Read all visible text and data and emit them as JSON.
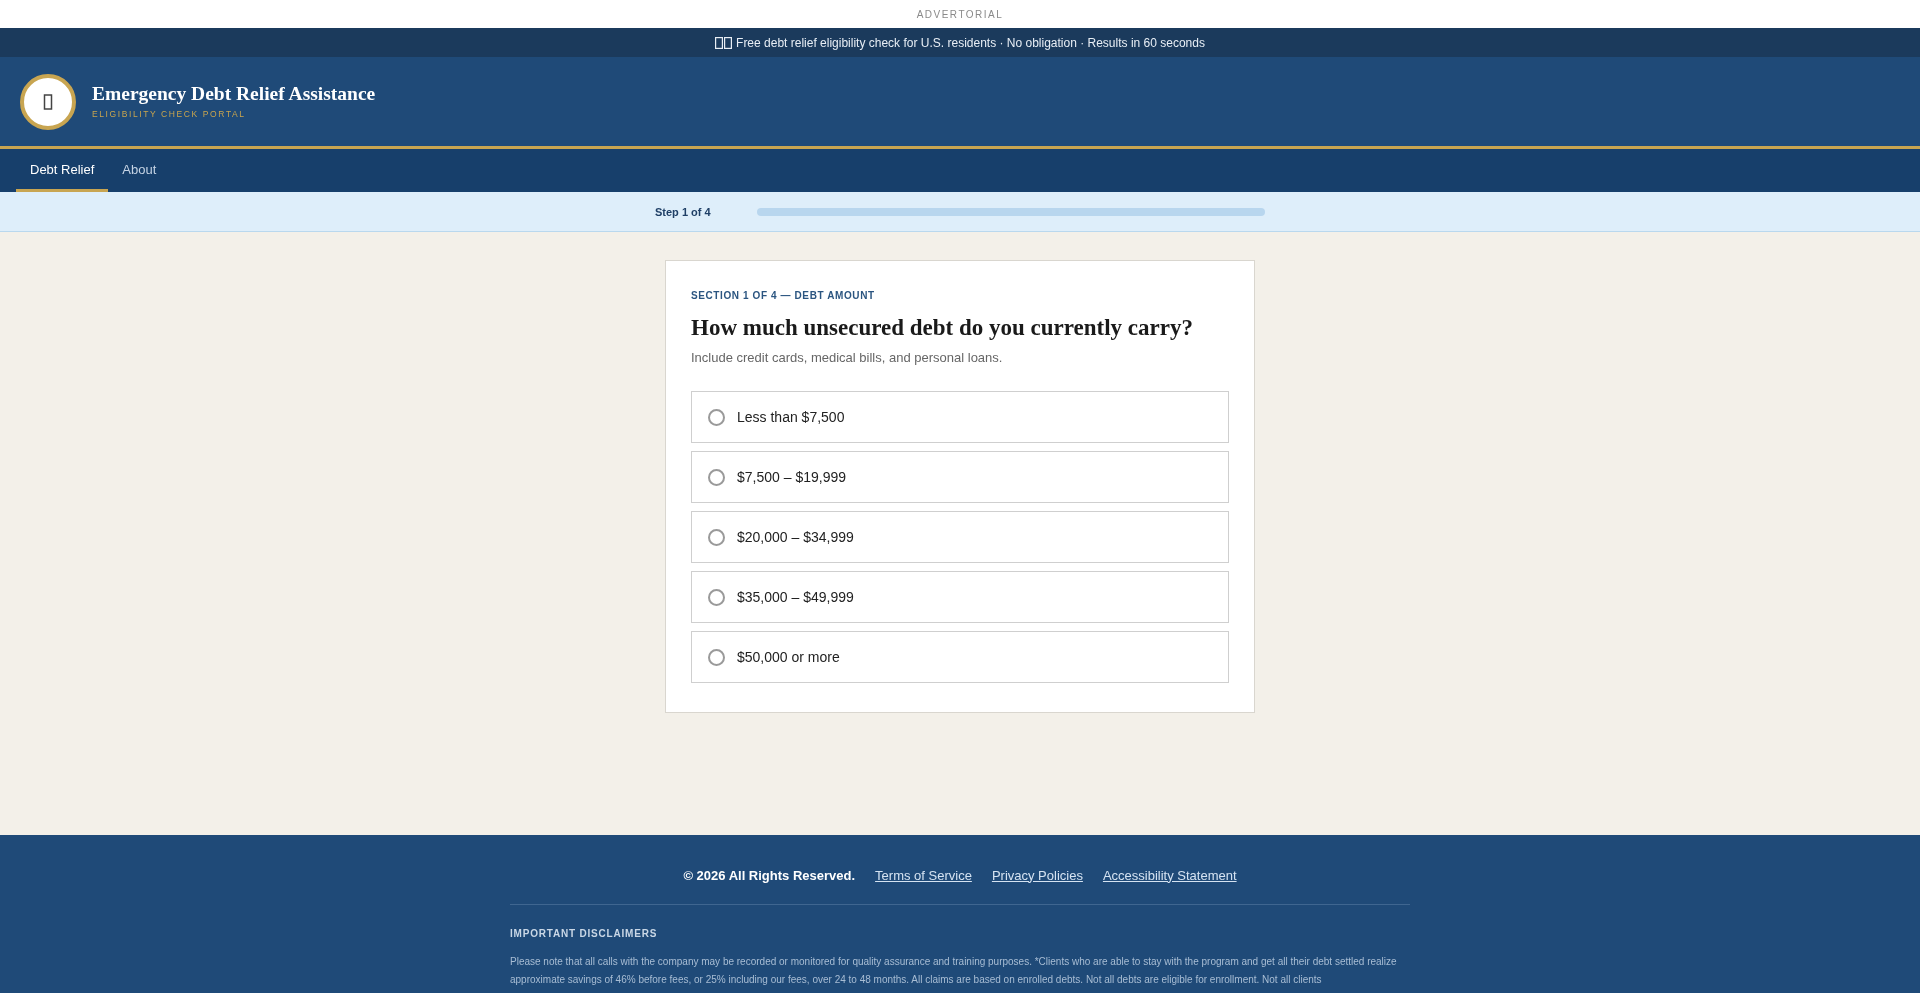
{
  "ad_label": "ADVERTORIAL",
  "banner": {
    "text": "Free debt relief eligibility check for U.S. residents · No obligation · Results in 60 seconds"
  },
  "header": {
    "title": "Emergency Debt Relief Assistance",
    "subtitle": "ELIGIBILITY CHECK PORTAL"
  },
  "nav": {
    "tabs": [
      {
        "label": "Debt Relief",
        "selected": true
      },
      {
        "label": "About",
        "selected": false
      }
    ]
  },
  "progress": {
    "label": "Step 1 of 4"
  },
  "question": {
    "eyebrow": "SECTION 1 OF 4 — DEBT AMOUNT",
    "title": "How much unsecured debt do you currently carry?",
    "hint": "Include credit cards, medical bills, and personal loans.",
    "options": [
      {
        "label": "Less than $7,500",
        "selected": false
      },
      {
        "label": "$7,500 – $19,999",
        "selected": false
      },
      {
        "label": "$20,000 – $34,999",
        "selected": false
      },
      {
        "label": "$35,000 – $49,999",
        "selected": false
      },
      {
        "label": "$50,000 or more",
        "selected": false
      }
    ]
  },
  "footer": {
    "copyright": "© 2026 All Rights Reserved.",
    "links": [
      "Terms of Service",
      "Privacy Policies",
      "Accessibility Statement"
    ],
    "disclaimer_title": "IMPORTANT DISCLAIMERS",
    "disclaimer": "Please note that all calls with the company may be recorded or monitored for quality assurance and training purposes. *Clients who are able to stay with the program and get all their debt settled realize approximate savings of 46% before fees, or 25% including our fees, over 24 to 48 months. All claims are based on enrolled debts. Not all debts are eligible for enrollment. Not all clients"
  }
}
